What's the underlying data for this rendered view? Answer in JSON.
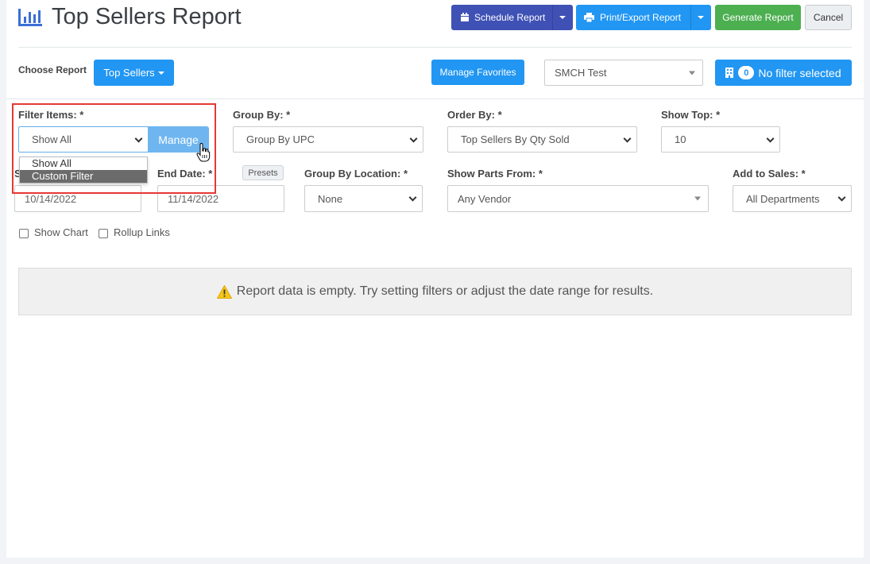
{
  "header": {
    "title": "Top Sellers Report",
    "icon": "bar-chart-icon"
  },
  "toolbar": {
    "schedule_label": "Schedule Report",
    "print_label": "Print/Export Report",
    "generate_label": "Generate Report",
    "cancel_label": "Cancel"
  },
  "choose_report": {
    "label": "Choose Report",
    "button_label": "Top Sellers",
    "manage_favorites_label": "Manage Favorites",
    "location_value": "SMCH Test",
    "filter_count": "0",
    "filter_label": "No filter selected"
  },
  "filters": {
    "filter_items_label": "Filter Items: *",
    "filter_items_value": "Show All",
    "manage_label": "Manage",
    "dropdown_options": [
      "Show All",
      "Custom Filter"
    ],
    "group_by_label": "Group By: *",
    "group_by_value": "Group By UPC",
    "order_by_label": "Order By: *",
    "order_by_value": "Top Sellers By Qty Sold",
    "show_top_label": "Show Top: *",
    "show_top_value": "10",
    "start_date_label": "S",
    "start_date_value": "10/14/2022",
    "end_date_label": "End Date: *",
    "end_date_value": "11/14/2022",
    "presets_label": "Presets",
    "group_by_location_label": "Group By Location: *",
    "group_by_location_value": "None",
    "show_parts_from_label": "Show Parts From: *",
    "show_parts_from_value": "Any Vendor",
    "add_to_sales_label": "Add to Sales: *",
    "add_to_sales_value": "All Departments"
  },
  "options": {
    "show_chart_label": "Show Chart",
    "rollup_links_label": "Rollup Links"
  },
  "alert": {
    "message": "Report data is empty. Try setting filters or adjust the date range for results."
  },
  "colors": {
    "primary": "#2196f3",
    "indigo": "#3f51b5",
    "green": "#4caf50",
    "highlight": "#e53935"
  }
}
